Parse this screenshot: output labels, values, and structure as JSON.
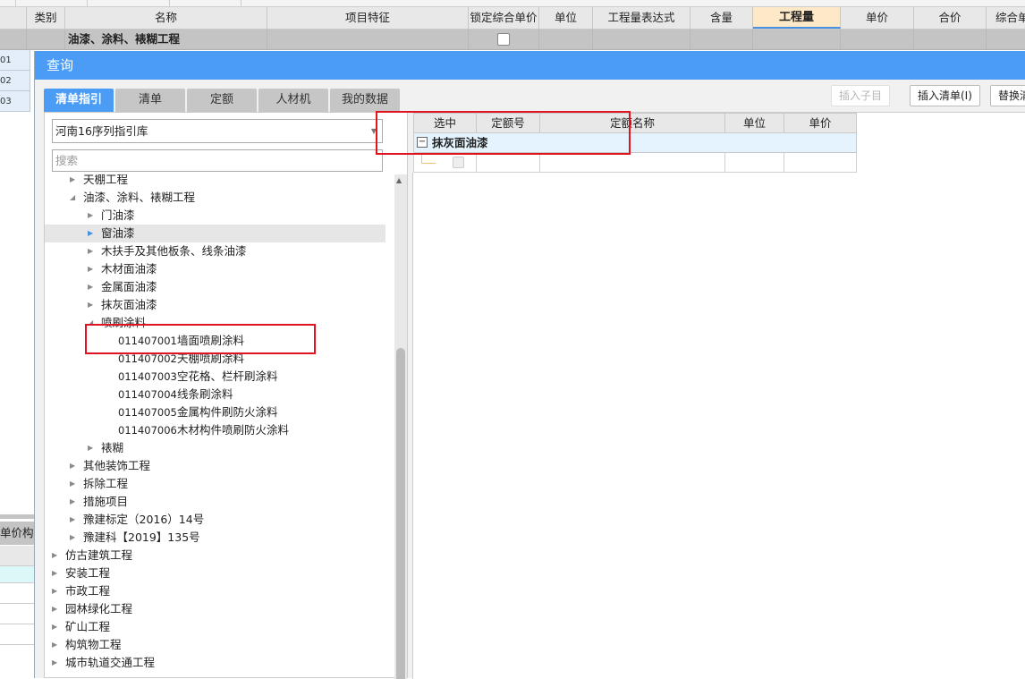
{
  "background_grid": {
    "columns": [
      {
        "label": "类别"
      },
      {
        "label": "名称"
      },
      {
        "label": "项目特征"
      },
      {
        "label": "锁定综合单价"
      },
      {
        "label": "单位"
      },
      {
        "label": "工程量表达式"
      },
      {
        "label": "含量"
      },
      {
        "label": "工程量",
        "active": true
      },
      {
        "label": "单价"
      },
      {
        "label": "合价"
      },
      {
        "label": "综合单"
      }
    ],
    "row1": {
      "name": "油漆、涂料、裱糊工程",
      "locked": false
    },
    "left_row_numbers": [
      "01",
      "02",
      "03"
    ],
    "lower_panel_label": "单价构成"
  },
  "dialog": {
    "title": "查询",
    "tabs": [
      {
        "label": "清单指引",
        "active": true
      },
      {
        "label": "清单"
      },
      {
        "label": "定额"
      },
      {
        "label": "人材机"
      },
      {
        "label": "我的数据"
      }
    ],
    "library_select": {
      "value": "河南16序列指引库"
    },
    "search": {
      "placeholder": "搜索",
      "value": ""
    },
    "toolbar": {
      "insert_child": {
        "label": "插入子目",
        "disabled": true
      },
      "insert_list": {
        "label": "插入清单(I)"
      },
      "replace": {
        "label": "替换清"
      }
    },
    "tree": [
      {
        "level": 1,
        "label": "天棚工程",
        "state": "collapsed"
      },
      {
        "level": 1,
        "label": "油漆、涂料、裱糊工程",
        "state": "expanded"
      },
      {
        "level": 2,
        "label": "门油漆",
        "state": "collapsed"
      },
      {
        "level": 2,
        "label": "窗油漆",
        "state": "collapsed",
        "selected": true
      },
      {
        "level": 2,
        "label": "木扶手及其他板条、线条油漆",
        "state": "collapsed"
      },
      {
        "level": 2,
        "label": "木材面油漆",
        "state": "collapsed"
      },
      {
        "level": 2,
        "label": "金属面油漆",
        "state": "collapsed"
      },
      {
        "level": 2,
        "label": "抹灰面油漆",
        "state": "collapsed"
      },
      {
        "level": 2,
        "label": "喷刷涂料",
        "state": "expanded"
      },
      {
        "level": 3,
        "code": "011407001",
        "label": "墙面喷刷涂料",
        "highlighted": true
      },
      {
        "level": 3,
        "code": "011407002",
        "label": "天棚喷刷涂料"
      },
      {
        "level": 3,
        "code": "011407003",
        "label": "空花格、栏杆刷涂料"
      },
      {
        "level": 3,
        "code": "011407004",
        "label": "线条刷涂料"
      },
      {
        "level": 3,
        "code": "011407005",
        "label": "金属构件刷防火涂料"
      },
      {
        "level": 3,
        "code": "011407006",
        "label": "木材构件喷刷防火涂料"
      },
      {
        "level": 2,
        "label": "裱糊",
        "state": "collapsed"
      },
      {
        "level": 1,
        "label": "其他装饰工程",
        "state": "collapsed"
      },
      {
        "level": 1,
        "label": "拆除工程",
        "state": "collapsed"
      },
      {
        "level": 1,
        "label": "措施项目",
        "state": "collapsed"
      },
      {
        "level": 1,
        "label": "豫建标定（2016）14号",
        "state": "collapsed"
      },
      {
        "level": 1,
        "label": "豫建科【2019】135号",
        "state": "collapsed"
      },
      {
        "level": 0,
        "label": "仿古建筑工程",
        "state": "collapsed"
      },
      {
        "level": 0,
        "label": "安装工程",
        "state": "collapsed"
      },
      {
        "level": 0,
        "label": "市政工程",
        "state": "collapsed"
      },
      {
        "level": 0,
        "label": "园林绿化工程",
        "state": "collapsed"
      },
      {
        "level": 0,
        "label": "矿山工程",
        "state": "collapsed"
      },
      {
        "level": 0,
        "label": "构筑物工程",
        "state": "collapsed"
      },
      {
        "level": 0,
        "label": "城市轨道交通工程",
        "state": "collapsed"
      }
    ],
    "result_table": {
      "columns": [
        "选中",
        "定额号",
        "定额名称",
        "单位",
        "单价"
      ],
      "group": {
        "label": "抹灰面油漆",
        "expanded": true
      },
      "rows": [
        {
          "selected": false,
          "code": "",
          "name": "",
          "unit": "",
          "price": ""
        }
      ]
    }
  },
  "colors": {
    "accent": "#4a9cf5",
    "highlight_box": "#e0141e",
    "active_column": "#fde8c8",
    "group_row": "#e4f3fd"
  }
}
